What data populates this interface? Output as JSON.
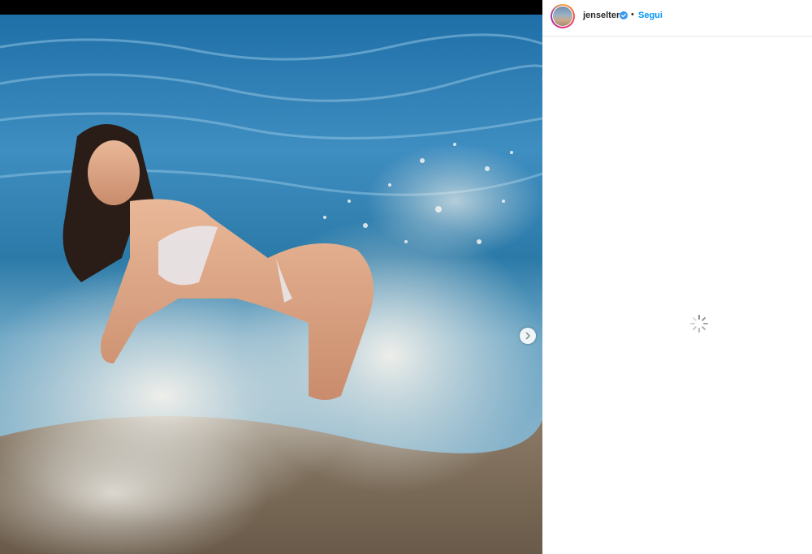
{
  "post": {
    "username": "jenselter",
    "separator": "•",
    "follow_label": "Segui",
    "verified": true
  },
  "icons": {
    "verified": "verified-badge-icon",
    "next": "chevron-right-icon",
    "loading": "loading-spinner-icon"
  },
  "colors": {
    "follow_blue": "#0095f6",
    "verified_blue": "#3897f0",
    "text": "#262626",
    "divider": "#e6e6e6"
  }
}
